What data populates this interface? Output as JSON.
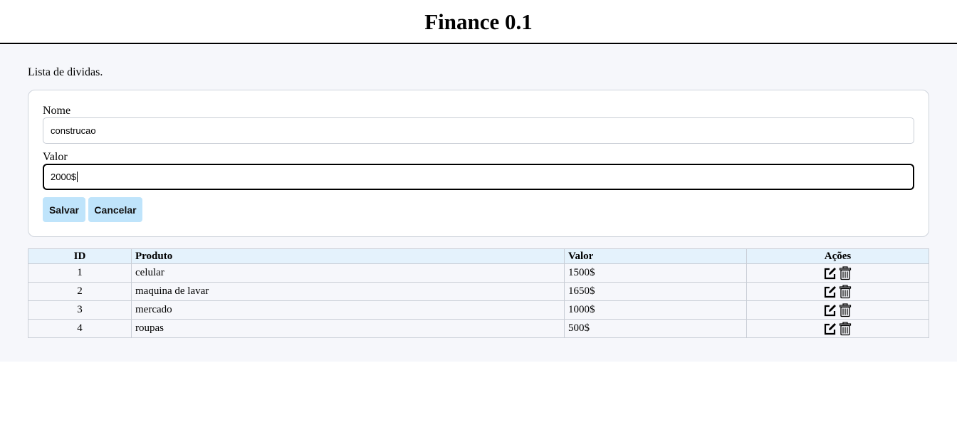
{
  "header": {
    "title": "Finance 0.1"
  },
  "main": {
    "subtitle": "Lista de dividas."
  },
  "form": {
    "nome_label": "Nome",
    "nome_value": "construcao",
    "valor_label": "Valor",
    "valor_value": "2000$",
    "salvar_label": "Salvar",
    "cancelar_label": "Cancelar"
  },
  "table": {
    "headers": [
      "ID",
      "Produto",
      "Valor",
      "Ações"
    ],
    "rows": [
      {
        "id": "1",
        "produto": "celular",
        "valor": "1500$"
      },
      {
        "id": "2",
        "produto": "maquina de lavar",
        "valor": "1650$"
      },
      {
        "id": "3",
        "produto": "mercado",
        "valor": "1000$"
      },
      {
        "id": "4",
        "produto": "roupas",
        "valor": "500$"
      }
    ],
    "action_icons": [
      "edit-icon",
      "trash-icon"
    ]
  },
  "colors": {
    "button_bg": "#bfe4fb",
    "table_header_bg": "#e4f2fc",
    "page_bg": "#f6f7fb"
  }
}
